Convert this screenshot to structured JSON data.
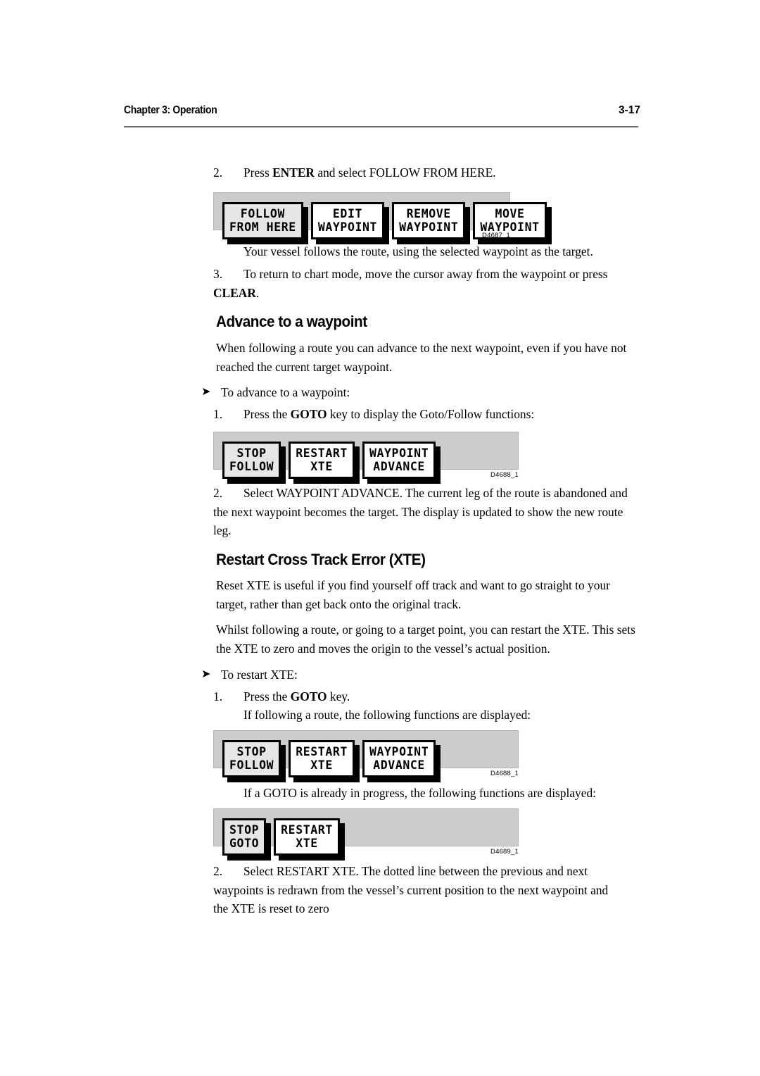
{
  "header": {
    "chapter": "Chapter 3: Operation",
    "page_number": "3-17"
  },
  "steps": {
    "step2_num": "2.",
    "step2_text_pre": "Press ",
    "step2_bold": "ENTER",
    "step2_text_post": " and select FOLLOW FROM HERE.",
    "vessel_follows": "Your vessel follows the route, using the selected waypoint as the target.",
    "step3_num": "3.",
    "step3_text": "To return to chart mode, move the cursor away from the waypoint or press",
    "step3_bold": "CLEAR",
    "step3_period": "."
  },
  "advance_section": {
    "heading": "Advance to a waypoint",
    "intro": "When following a route you can advance to the next waypoint, even if you have not reached the current target waypoint.",
    "arrow_bullet": "To advance to a waypoint:",
    "arrow_glyph": "➤",
    "step1_num": "1.",
    "step1_pre": "Press the ",
    "step1_bold": "GOTO",
    "step1_post": " key to display the Goto/Follow functions:",
    "step2_num": "2.",
    "step2_text": "Select WAYPOINT ADVANCE. The current leg of the route is abandoned and the next waypoint becomes the target. The display is updated to show the new route leg."
  },
  "xte_section": {
    "heading": "Restart Cross Track Error (XTE)",
    "para1": "Reset XTE is useful if you find yourself off track and want to go straight to your target, rather than get back onto the original track.",
    "para2": "Whilst following a route, or going to a target point, you can restart the XTE. This sets the XTE to zero and moves the origin to the vessel’s actual position.",
    "arrow_bullet": "To restart XTE:",
    "arrow_glyph": "➤",
    "step1_num": "1.",
    "step1_pre": "Press the ",
    "step1_bold": "GOTO",
    "step1_post": " key.",
    "step1_sub": "If following a route, the following functions are displayed:",
    "goto_in_progress": "If a GOTO is already in progress, the following functions are displayed:",
    "step2_num": "2.",
    "step2_text": "Select RESTART XTE. The dotted line between the previous and next waypoints is redrawn from the vessel’s current  position to the next waypoint and the XTE is reset to zero"
  },
  "figures": [
    {
      "id": "figure-waypoint-options",
      "caption": "D4687_1",
      "keys": [
        {
          "line1": "FOLLOW",
          "line2": "FROM HERE",
          "selected": true
        },
        {
          "line1": "EDIT",
          "line2": "WAYPOINT",
          "selected": false
        },
        {
          "line1": "REMOVE",
          "line2": "WAYPOINT",
          "selected": false
        },
        {
          "line1": "MOVE",
          "line2": "WAYPOINT",
          "selected": false
        }
      ]
    },
    {
      "id": "figure-goto-follow-functions",
      "caption": "D4688_1",
      "keys": [
        {
          "line1": "STOP",
          "line2": "FOLLOW",
          "selected": true
        },
        {
          "line1": "RESTART",
          "line2": "XTE",
          "selected": false
        },
        {
          "line1": "WAYPOINT",
          "line2": "ADVANCE",
          "selected": false
        }
      ]
    },
    {
      "id": "figure-goto-follow-functions-2",
      "caption": "D4688_1",
      "keys": [
        {
          "line1": "STOP",
          "line2": "FOLLOW",
          "selected": true
        },
        {
          "line1": "RESTART",
          "line2": "XTE",
          "selected": false
        },
        {
          "line1": "WAYPOINT",
          "line2": "ADVANCE",
          "selected": false
        }
      ]
    },
    {
      "id": "figure-goto-in-progress",
      "caption": "D4689_1",
      "keys": [
        {
          "line1": "STOP",
          "line2": "GOTO",
          "selected": true
        },
        {
          "line1": "RESTART",
          "line2": "XTE",
          "selected": false
        }
      ]
    }
  ],
  "colors": {
    "panel_bg": "#cccccc",
    "key_face": "#ffffff",
    "key_selected": "#e6e6e6",
    "rule": "#6f6f6f"
  }
}
